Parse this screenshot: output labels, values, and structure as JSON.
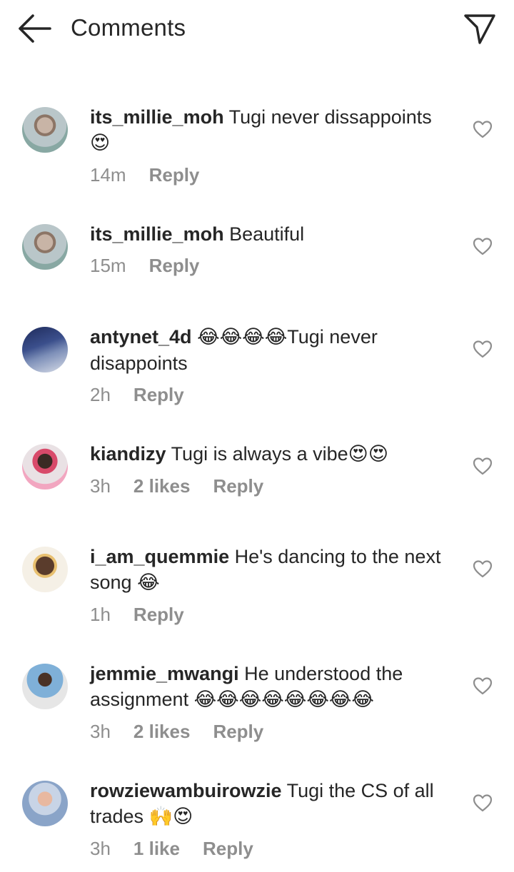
{
  "header": {
    "title": "Comments",
    "back_icon": "arrow-left-icon",
    "share_icon": "send-icon"
  },
  "comments": [
    {
      "username": "its_millie_moh",
      "text": "Tugi never dissappoints",
      "emoji_after": "😍",
      "time": "14m",
      "likes": "",
      "reply": "Reply"
    },
    {
      "username": "its_millie_moh",
      "text": "Beautiful",
      "emoji_after": "",
      "time": "15m",
      "likes": "",
      "reply": "Reply"
    },
    {
      "username": "antynet_4d",
      "emoji_before": "😂😂😂😂",
      "text": "Tugi never disappoints",
      "time": "2h",
      "likes": "",
      "reply": "Reply"
    },
    {
      "username": "kiandizy",
      "text": "Tugi is always a vibe",
      "emoji_after": "😍😍",
      "time": "3h",
      "likes": "2 likes",
      "reply": "Reply"
    },
    {
      "username": "i_am_quemmie",
      "text": "He's dancing to the next song",
      "emoji_after": "😂",
      "time": "1h",
      "likes": "",
      "reply": "Reply"
    },
    {
      "username": "jemmie_mwangi",
      "text": "He understood the assignment",
      "emoji_after": "😂😂😂😂😂😂😂😂",
      "time": "3h",
      "likes": "2 likes",
      "reply": "Reply"
    },
    {
      "username": "rowziewambuirowzie",
      "text": "Tugi the CS of all trades",
      "emoji_after": "🙌😍",
      "time": "3h",
      "likes": "1 like",
      "reply": "Reply"
    }
  ]
}
